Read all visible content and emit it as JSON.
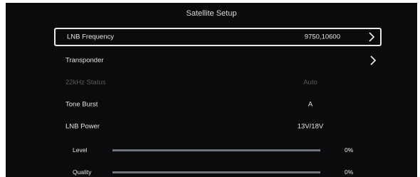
{
  "screen": {
    "title": "Satellite Setup"
  },
  "menu": [
    {
      "label": "LNB Frequency",
      "value": "9750,10600",
      "selected": true,
      "disabled": false,
      "chevron": true
    },
    {
      "label": "Transponder",
      "value": "",
      "selected": false,
      "disabled": false,
      "chevron": true
    },
    {
      "label": "22kHz Status",
      "value": "Auto",
      "selected": false,
      "disabled": true,
      "chevron": false
    },
    {
      "label": "Tone Burst",
      "value": "A",
      "selected": false,
      "disabled": false,
      "chevron": false
    },
    {
      "label": "LNB Power",
      "value": "13V/18V",
      "selected": false,
      "disabled": false,
      "chevron": false
    }
  ],
  "meters": [
    {
      "label": "Level",
      "value_text": "0%",
      "value": 0
    },
    {
      "label": "Quality",
      "value_text": "0%",
      "value": 0
    }
  ],
  "icons": {
    "chevron": "chevron-right-icon"
  },
  "colors": {
    "background": "#0b0b0d",
    "text": "#e6e6e6",
    "disabled_text": "#5d5d60",
    "selection_border": "#e8e8e8",
    "meter_track": "#6e7480"
  }
}
